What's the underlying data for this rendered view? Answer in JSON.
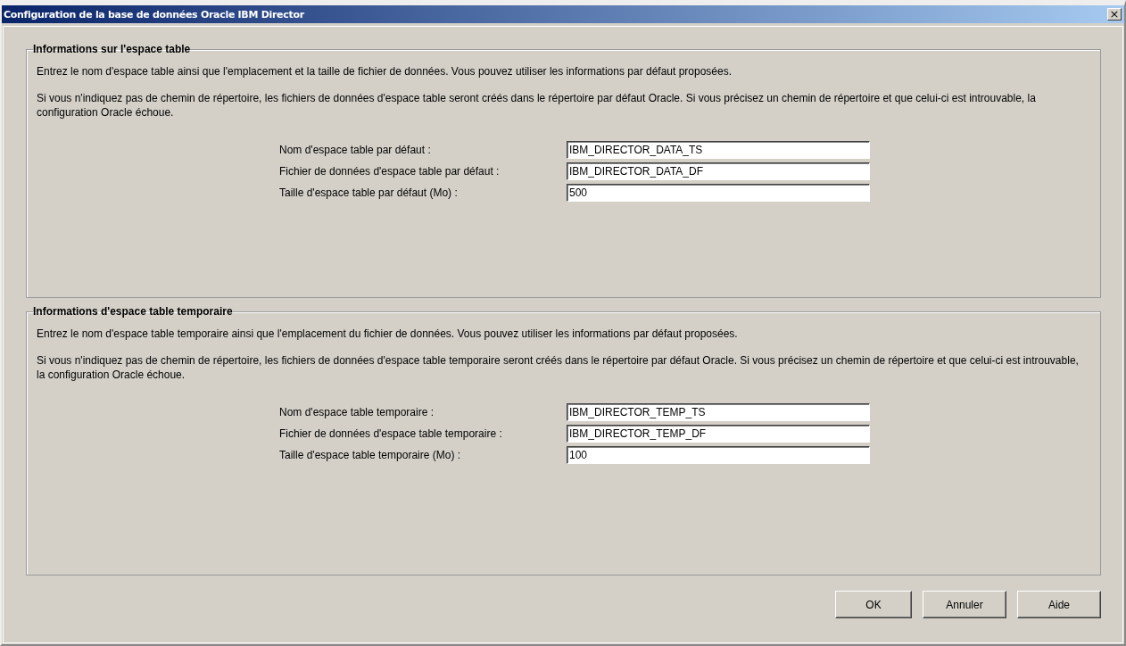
{
  "window": {
    "title": "Configuration de la base de données Oracle IBM Director",
    "close": "×"
  },
  "sections": [
    {
      "title": "Informations sur l'espace table",
      "paragraphs": [
        "Entrez le nom d'espace table ainsi que l'emplacement et la taille de fichier de données. Vous pouvez utiliser les informations par défaut proposées.",
        "Si vous n'indiquez pas de chemin de répertoire, les fichiers de données d'espace table seront créés dans le répertoire par défaut Oracle. Si vous précisez un chemin de répertoire et que celui-ci est introuvable, la configuration Oracle échoue."
      ],
      "fields": [
        {
          "label": "Nom d'espace table par défaut :",
          "value": "IBM_DIRECTOR_DATA_TS"
        },
        {
          "label": "Fichier de données d'espace table par défaut :",
          "value": "IBM_DIRECTOR_DATA_DF"
        },
        {
          "label": "Taille d'espace table par défaut (Mo) :",
          "value": "500"
        }
      ]
    },
    {
      "title": "Informations d'espace table temporaire",
      "paragraphs": [
        "Entrez le nom d'espace table temporaire ainsi que l'emplacement du fichier de données. Vous pouvez utiliser les informations par défaut proposées.",
        "Si vous n'indiquez pas de chemin de répertoire, les fichiers de données d'espace table temporaire seront créés dans le répertoire par défaut Oracle. Si vous précisez un chemin de répertoire et que celui-ci est introuvable, la configuration Oracle échoue."
      ],
      "fields": [
        {
          "label": "Nom d'espace table temporaire :",
          "value": "IBM_DIRECTOR_TEMP_TS"
        },
        {
          "label": "Fichier de données d'espace table temporaire :",
          "value": "IBM_DIRECTOR_TEMP_DF"
        },
        {
          "label": "Taille d'espace table temporaire (Mo) :",
          "value": "100"
        }
      ]
    }
  ],
  "buttons": [
    "OK",
    "Annuler",
    "Aide"
  ]
}
